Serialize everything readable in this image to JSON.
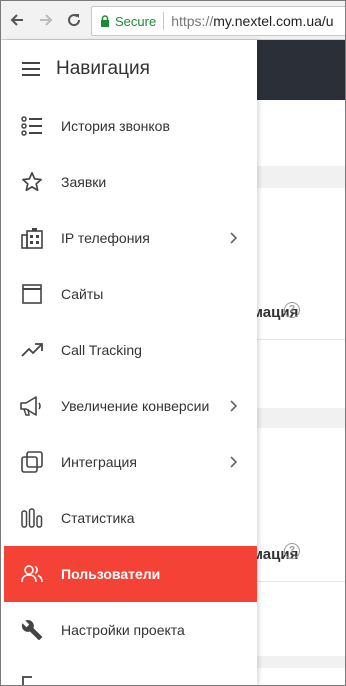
{
  "browser": {
    "secure_label": "Secure",
    "url_proto": "https://",
    "url_host": "my.nextel.com.ua/u"
  },
  "background_page": {
    "suffix_1": "Информация",
    "suffix_2": "Информация",
    "help_glyph": "?"
  },
  "drawer": {
    "title": "Навигация",
    "items": [
      {
        "label": "История звонков",
        "icon": "call-history-list-icon"
      },
      {
        "label": "Заявки",
        "icon": "star-icon"
      },
      {
        "label": "IP телефония",
        "icon": "office-building-icon",
        "has_submenu": true
      },
      {
        "label": "Сайты",
        "icon": "browser-window-icon"
      },
      {
        "label": "Call Tracking",
        "icon": "trending-up-icon"
      },
      {
        "label": "Увеличение конверсии",
        "icon": "megaphone-icon",
        "has_submenu": true
      },
      {
        "label": "Интеграция",
        "icon": "layers-icon",
        "has_submenu": true
      },
      {
        "label": "Статистика",
        "icon": "bar-chart-icon"
      },
      {
        "label": "Пользователи",
        "icon": "users-icon",
        "active": true
      },
      {
        "label": "Настройки проекта",
        "icon": "wrench-icon"
      }
    ]
  },
  "colors": {
    "active_item_bg": "#f44336",
    "secure_green": "#1b8a36",
    "header_dark": "#2b2f37"
  }
}
